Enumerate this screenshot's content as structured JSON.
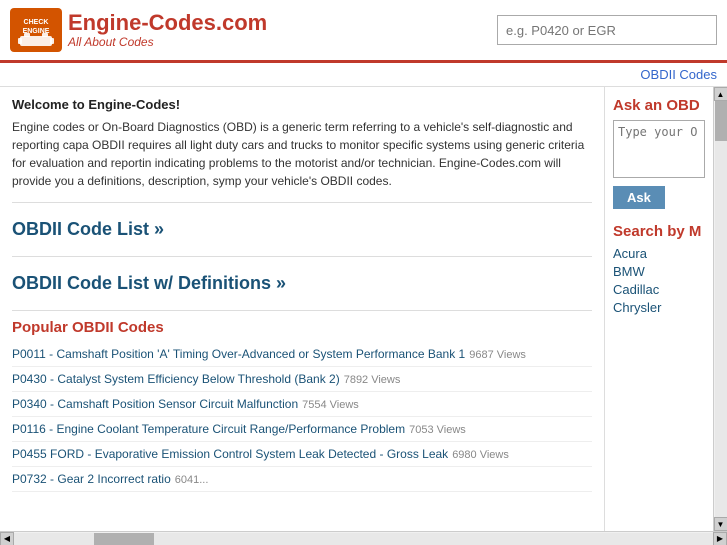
{
  "header": {
    "logo_title": "Engine-Codes.com",
    "logo_subtitle": "All About Codes",
    "search_placeholder": "e.g. P0420 or EGR"
  },
  "nav": {
    "obdii_codes_label": "OBDII Codes"
  },
  "content": {
    "welcome_title": "Welcome to Engine-Codes!",
    "intro_text": "Engine codes or On-Board Diagnostics (OBD) is a generic term referring to a vehicle's self-diagnostic and reporting capa OBDII requires all light duty cars and trucks to monitor specific systems using generic criteria for evaluation and reportin indicating problems to the motorist and/or technician. Engine-Codes.com will provide you a definitions, description, symp your vehicle's OBDII codes.",
    "code_list_1": "OBDII Code List »",
    "code_list_2": "OBDII Code List w/ Definitions »",
    "popular_title": "Popular OBDII Codes",
    "codes": [
      {
        "text": "P0011 - Camshaft Position 'A' Timing Over-Advanced or System Performance Bank 1",
        "views": "9687 Views"
      },
      {
        "text": "P0430 - Catalyst System Efficiency Below Threshold (Bank 2)",
        "views": "7892 Views"
      },
      {
        "text": "P0340 - Camshaft Position Sensor Circuit Malfunction",
        "views": "7554 Views"
      },
      {
        "text": "P0116 - Engine Coolant Temperature Circuit Range/Performance Problem",
        "views": "7053 Views"
      },
      {
        "text": "P0455 FORD - Evaporative Emission Control System Leak Detected - Gross Leak",
        "views": "6980 Views"
      },
      {
        "text": "P0732 - Gear 2 Incorrect ratio",
        "views": "6041..."
      }
    ]
  },
  "sidebar": {
    "ask_obd_title": "Ask an OBD",
    "ask_placeholder": "Type your O",
    "ask_button_label": "Ask",
    "search_make_title": "Search by M",
    "makes": [
      "Acura",
      "BMW",
      "Cadillac",
      "Chrysler"
    ]
  }
}
